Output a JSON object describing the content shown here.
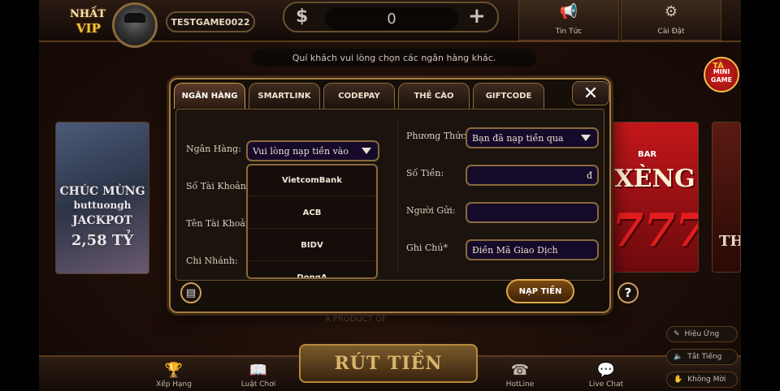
{
  "topbar": {
    "vip_logo_line1": "NHẤT",
    "vip_logo_line2": "VIP",
    "username": "TESTGAME0022",
    "currency_symbol": "$",
    "balance": "0",
    "add_symbol": "+",
    "news_label": "Tin Tức",
    "settings_label": "Cài Đặt"
  },
  "notice": "Quí khách vui lòng chọn các ngân hàng khác.",
  "mini_game": {
    "prefix": "TÀ",
    "line1": "MINI",
    "line2": "GAME"
  },
  "cards": {
    "left_lines": [
      "CHÚC MỪNG",
      "buttuongh",
      "JACKPOT",
      "2,58 TỶ"
    ],
    "right_bar": "BAR",
    "right_title": "XÈNG",
    "right_number": "777",
    "far_text": "TH"
  },
  "modal": {
    "tabs": [
      "NGÂN HÀNG",
      "SMARTLINK",
      "CODEPAY",
      "THẺ CÀO",
      "GIFTCODE"
    ],
    "active_tab": 0,
    "close_symbol": "✕",
    "left": {
      "bank_label": "Ngân Hàng:",
      "bank_value": "Vui lòng nạp tiền vào",
      "account_number_label": "Số Tài Khoản:",
      "account_name_label": "Tên Tài Khoản:",
      "branch_label": "Chi Nhánh:",
      "bank_options": [
        "VietcomBank",
        "ACB",
        "BIDV",
        "DongA"
      ]
    },
    "right": {
      "method_label": "Phương Thức:",
      "method_value": "Bạn đã nạp tiền qua",
      "amount_label": "Số Tiền:",
      "amount_suffix": "đ",
      "sender_label": "Người Gửi:",
      "note_label": "Ghi Chú*",
      "note_placeholder": "Điền Mã Giao Dịch"
    },
    "submit_label": "NẠP TIỀN",
    "help_symbol": "?"
  },
  "bottombar": {
    "items": [
      "Xếp Hạng",
      "Luật Chơi",
      "HotLine",
      "Live Chat"
    ],
    "withdraw_label": "RÚT TIỀN",
    "product_text": "A PRODUCT OF"
  },
  "side_buttons": [
    "Hiệu Ứng",
    "Tắt Tiếng",
    "Không Mời"
  ]
}
